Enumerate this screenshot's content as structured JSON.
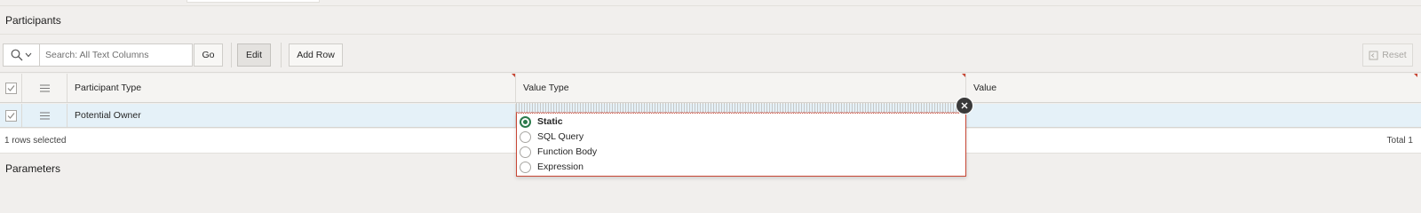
{
  "participants": {
    "title": "Participants",
    "toolbar": {
      "search_placeholder": "Search: All Text Columns",
      "go_label": "Go",
      "edit_label": "Edit",
      "add_row_label": "Add Row",
      "reset_label": "Reset",
      "search_icon": "search-icon",
      "accent_color": "#c74634"
    },
    "grid": {
      "columns": [
        "Participant Type",
        "Value Type",
        "Value"
      ],
      "rows": [
        {
          "participant_type": "Potential Owner",
          "selected": true
        }
      ],
      "selection_status": "1 rows selected",
      "total": "Total 1",
      "selected_row_color": "#e5f1f8"
    },
    "value_type_popup": {
      "options": [
        "Static",
        "SQL Query",
        "Function Body",
        "Expression"
      ],
      "selected": "Static",
      "selected_color": "#2b7a4b"
    }
  },
  "parameters": {
    "title": "Parameters"
  }
}
